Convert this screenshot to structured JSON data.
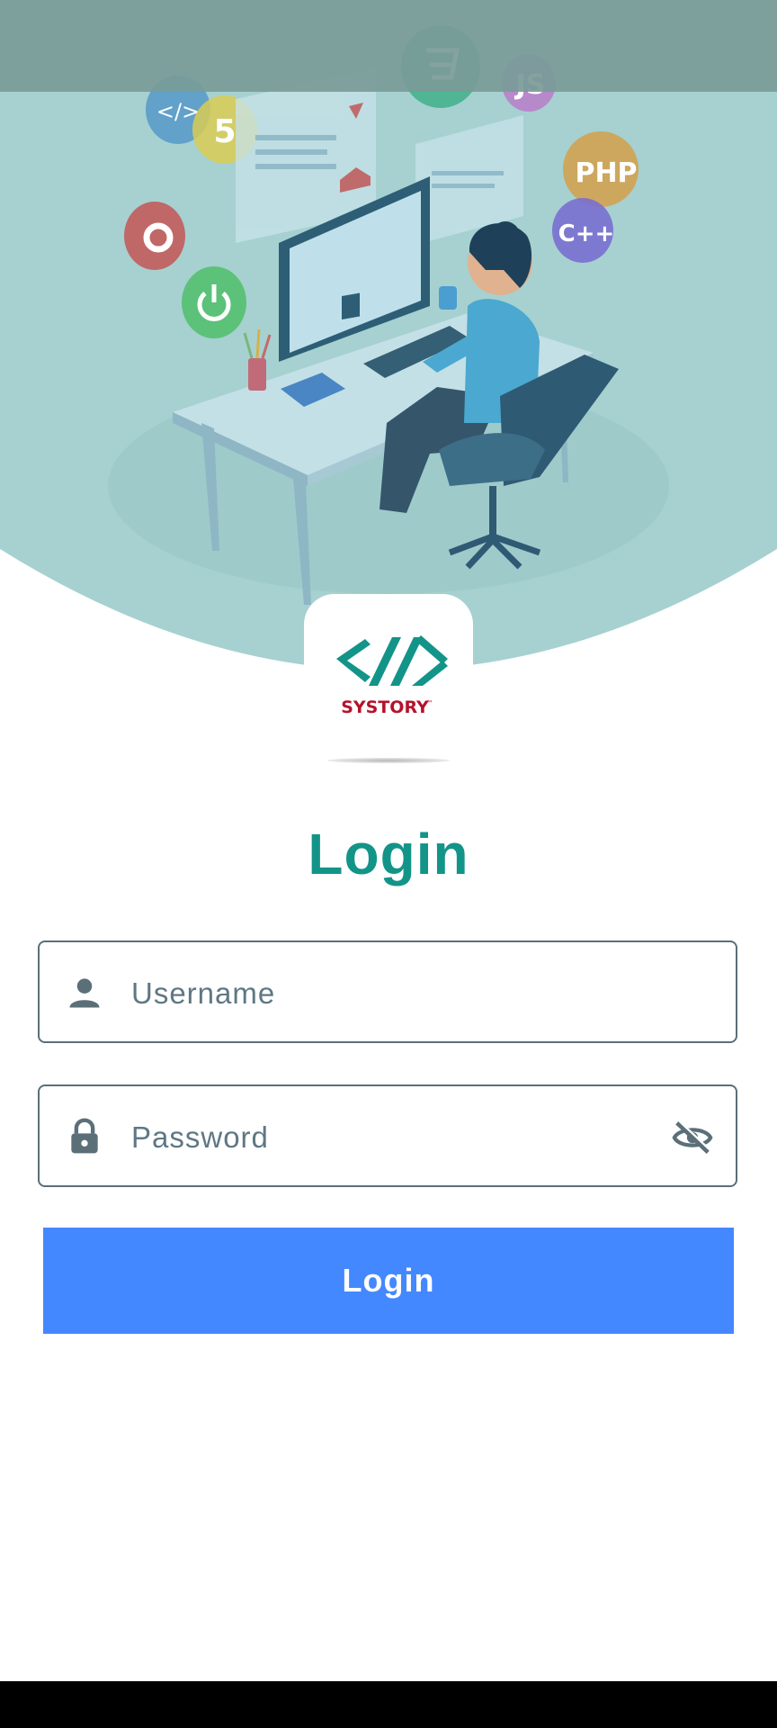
{
  "hero": {
    "illustration": "developer-at-desk-illustration",
    "badges": [
      "</>",
      "5",
      "JS",
      "PHP",
      "C++"
    ]
  },
  "logo": {
    "brand_text": "SYSTORY",
    "trademark": "™",
    "icon": "systory-logo"
  },
  "login": {
    "title": "Login",
    "username": {
      "value": "",
      "placeholder": "Username",
      "icon": "person-icon"
    },
    "password": {
      "value": "",
      "placeholder": "Password",
      "icon": "lock-icon",
      "toggle_icon": "eye-off-icon"
    },
    "button_label": "Login"
  },
  "colors": {
    "accent": "#139488",
    "button": "#4488ff",
    "hero_bg": "#a6d1d0",
    "field_border": "#5b6f79",
    "brand_red": "#b5122a"
  }
}
